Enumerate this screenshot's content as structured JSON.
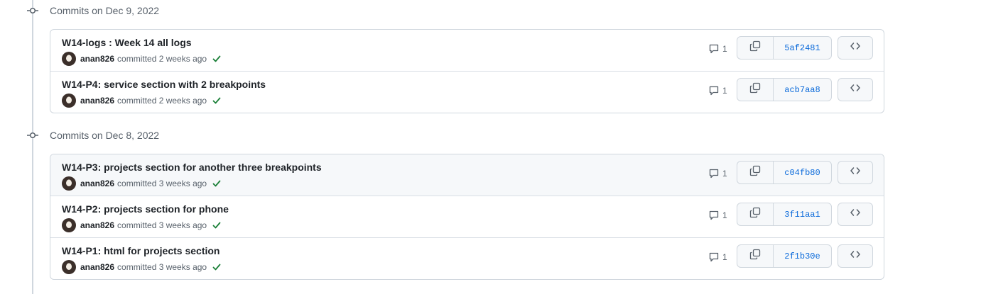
{
  "groups": [
    {
      "title": "Commits on Dec 9, 2022",
      "commits": [
        {
          "message": "W14-logs : Week 14 all logs",
          "author": "anan826",
          "committed": "committed 2 weeks ago",
          "comments": "1",
          "sha": "5af2481"
        },
        {
          "message": "W14-P4: service section with 2 breakpoints",
          "author": "anan826",
          "committed": "committed 2 weeks ago",
          "comments": "1",
          "sha": "acb7aa8"
        }
      ]
    },
    {
      "title": "Commits on Dec 8, 2022",
      "commits": [
        {
          "message": "W14-P3: projects section for another three breakpoints",
          "author": "anan826",
          "committed": "committed 3 weeks ago",
          "comments": "1",
          "sha": "c04fb80"
        },
        {
          "message": "W14-P2: projects section for phone",
          "author": "anan826",
          "committed": "committed 3 weeks ago",
          "comments": "1",
          "sha": "3f11aa1"
        },
        {
          "message": "W14-P1: html for projects section",
          "author": "anan826",
          "committed": "committed 3 weeks ago",
          "comments": "1",
          "sha": "2f1b30e"
        }
      ]
    }
  ],
  "icons": {
    "commit_node": "git-commit-icon",
    "comment": "comment-icon",
    "copy": "copy-icon",
    "browse": "code-icon",
    "status": "check-icon"
  },
  "colors": {
    "link": "#0969da",
    "success": "#1a7f37",
    "muted": "#57606a",
    "border": "#d0d7de"
  }
}
